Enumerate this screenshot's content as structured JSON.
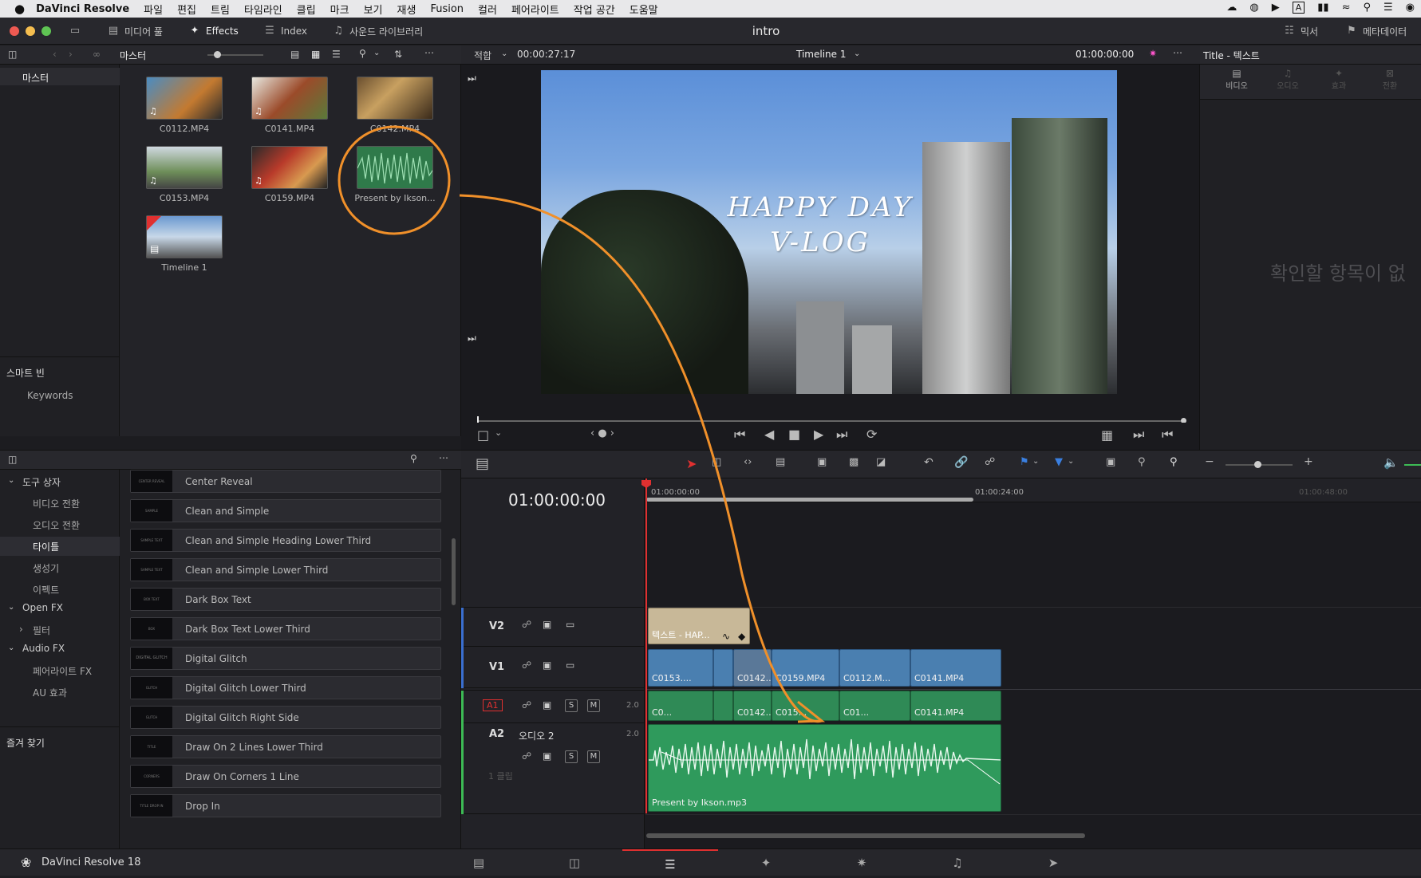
{
  "menubar": {
    "app": "DaVinci Resolve",
    "items": [
      "파일",
      "편집",
      "트림",
      "타임라인",
      "클립",
      "마크",
      "보기",
      "재생",
      "Fusion",
      "컬러",
      "페어라이트",
      "작업 공간",
      "도움말"
    ]
  },
  "toolbar": {
    "media_pool": "미디어 풀",
    "effects": "Effects",
    "index": "Index",
    "sound_library": "사운드 라이브러리",
    "project_title": "intro",
    "mixer": "믹서",
    "metadata": "메타데이터"
  },
  "media": {
    "bin_title": "마스터",
    "sidebar_master": "마스터",
    "smart_bin": "스마트 빈",
    "keywords": "Keywords",
    "clips": [
      {
        "name": "C0112.MP4"
      },
      {
        "name": "C0141.MP4"
      },
      {
        "name": "C0142.MP4"
      },
      {
        "name": "C0153.MP4"
      },
      {
        "name": "C0159.MP4"
      },
      {
        "name": "Present by Ikson..."
      },
      {
        "name": "Timeline 1"
      }
    ]
  },
  "viewer": {
    "zoom": "적합",
    "timecode_left": "00:00:27:17",
    "timeline_name": "Timeline 1",
    "timecode_right": "01:00:00:00",
    "overlay_line1": "HAPPY DAY",
    "overlay_line2": "V-LOG"
  },
  "inspector": {
    "title": "Title - 텍스트",
    "tabs": [
      "비디오",
      "오디오",
      "효과",
      "전환"
    ],
    "placeholder": "확인할 항목이 없"
  },
  "effects": {
    "tree": [
      {
        "label": "도구 상자",
        "level": 0
      },
      {
        "label": "비디오 전환",
        "level": 1
      },
      {
        "label": "오디오 전환",
        "level": 1
      },
      {
        "label": "타이틀",
        "level": 1,
        "selected": true
      },
      {
        "label": "생성기",
        "level": 1
      },
      {
        "label": "이펙트",
        "level": 1
      },
      {
        "label": "Open FX",
        "level": 0
      },
      {
        "label": "필터",
        "level": 1
      },
      {
        "label": "Audio FX",
        "level": 0
      },
      {
        "label": "페어라이트 FX",
        "level": 1
      },
      {
        "label": "AU 효과",
        "level": 1
      }
    ],
    "favorites": "즐겨 찾기",
    "titles": [
      "Center Reveal",
      "Clean and Simple",
      "Clean and Simple Heading Lower Third",
      "Clean and Simple Lower Third",
      "Dark Box Text",
      "Dark Box Text Lower Third",
      "Digital Glitch",
      "Digital Glitch Lower Third",
      "Digital Glitch Right Side",
      "Draw On 2 Lines Lower Third",
      "Draw On Corners 1 Line",
      "Drop In"
    ]
  },
  "timeline": {
    "timecode": "01:00:00:00",
    "ruler": [
      "01:00:00:00",
      "01:00:24:00",
      "01:00:48:00"
    ],
    "tracks": {
      "v2": "V2",
      "v1": "V1",
      "a1": "A1",
      "a2": "A2",
      "a2_name": "오디오 2",
      "a1_ch": "2.0",
      "a2_ch": "2.0",
      "clip_count": "1 클립"
    },
    "v2_clip": "텍스트 - HAP...",
    "v1_clips": [
      "C0153....",
      "",
      "C0142...",
      "C0159.MP4",
      "C0112.M...",
      "C0141.MP4"
    ],
    "a1_clips": [
      "C0...",
      "",
      "C0142...",
      "C015...",
      "C01...",
      "C0141.MP4"
    ],
    "a2_clip": "Present by Ikson.mp3"
  },
  "bottom": {
    "app_version": "DaVinci Resolve 18"
  },
  "colors": {
    "accent_orange": "#f0902a",
    "video_clip": "#4a7fb0",
    "audio_clip": "#2f8a56",
    "title_clip": "#c8b898",
    "playhead": "#e03030"
  }
}
